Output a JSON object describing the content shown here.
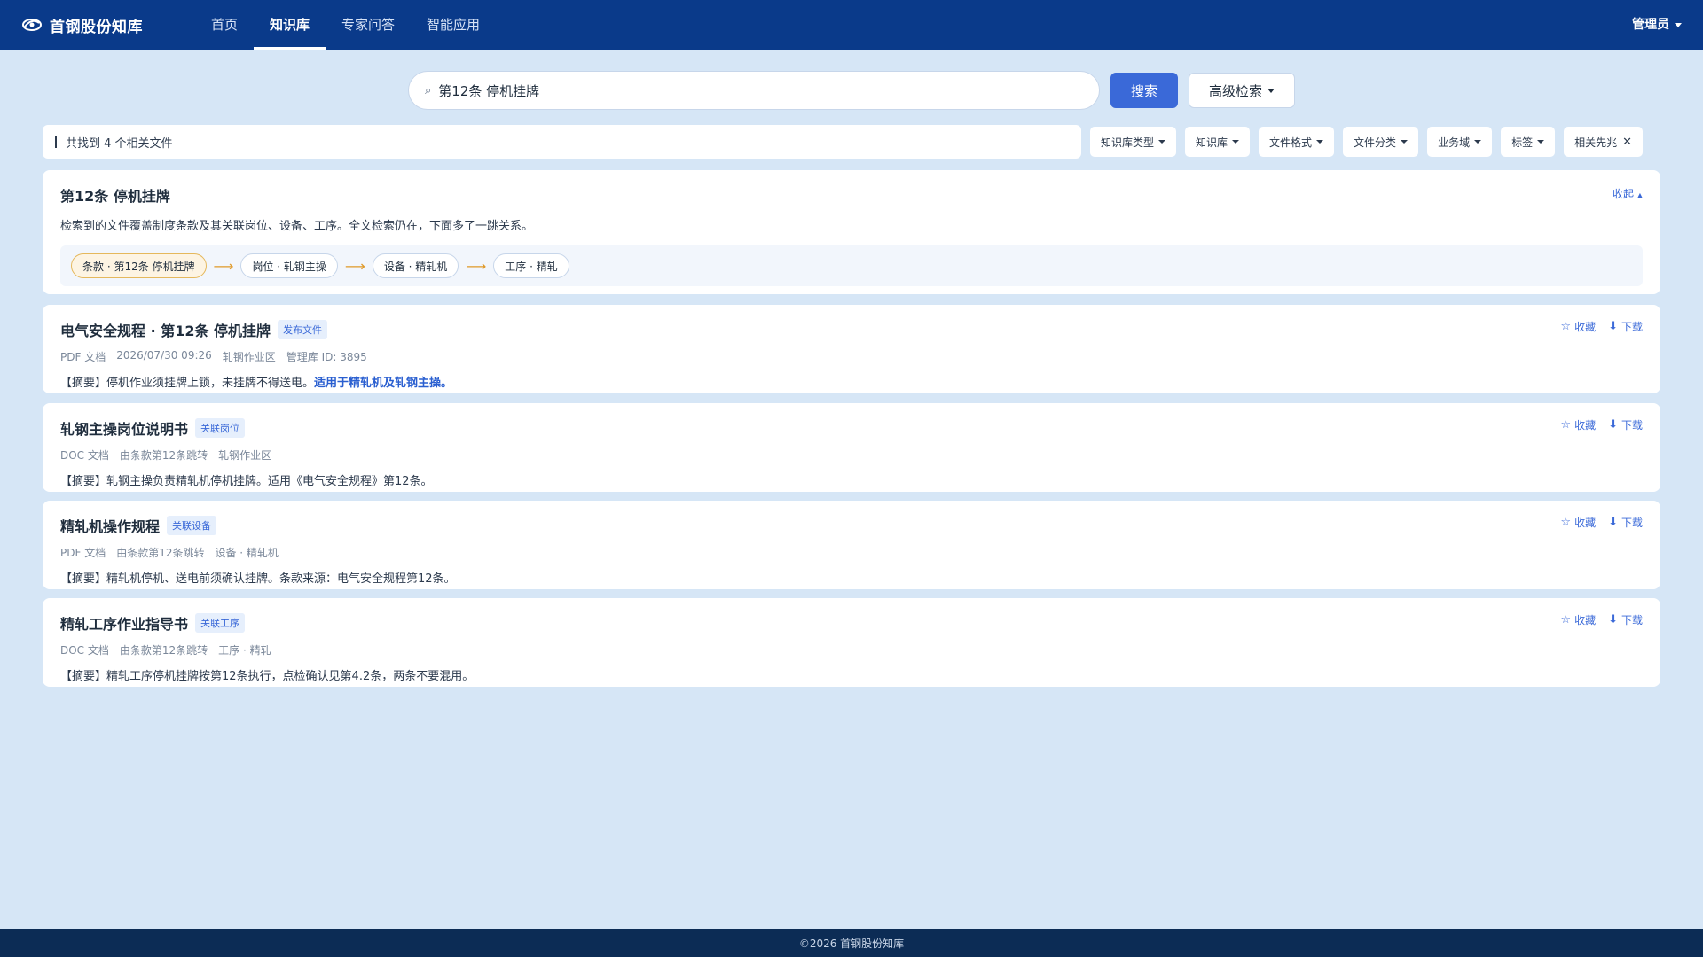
{
  "header": {
    "brand": "首钢股份知库",
    "nav": [
      "首页",
      "知识库",
      "专家问答",
      "智能应用"
    ],
    "active_nav": 1,
    "user": "管理员"
  },
  "search": {
    "query": "第12条 停机挂牌",
    "search_label": "搜索",
    "advanced_label": "高级检索"
  },
  "filters": {
    "result_count": "共找到 4 个相关文件",
    "chips": [
      "知识库类型",
      "知识库",
      "文件格式",
      "文件分类",
      "业务域",
      "标签"
    ],
    "active_chip": "相关先兆"
  },
  "summary": {
    "title": "第12条 停机挂牌",
    "collapse": "收起",
    "description": "检索到的文件覆盖制度条款及其关联岗位、设备、工序。全文检索仍在，下面多了一跳关系。",
    "chain": [
      "条款 · 第12条 停机挂牌",
      "岗位 · 轧钢主操",
      "设备 · 精轧机",
      "工序 · 精轧"
    ]
  },
  "results": [
    {
      "title": "电气安全规程 · 第12条 停机挂牌",
      "tag": "发布文件",
      "meta": [
        "PDF 文档",
        "2026/07/30 09:26",
        "轧钢作业区",
        "管理库 ID: 3895"
      ],
      "abstract": "【摘要】停机作业须挂牌上锁，未挂牌不得送电。",
      "abstract_highlight": "适用于精轧机及轧钢主操。",
      "fav": "收藏",
      "download": "下载"
    },
    {
      "title": "轧钢主操岗位说明书",
      "tag": "关联岗位",
      "meta": [
        "DOC 文档",
        "由条款第12条跳转",
        "轧钢作业区"
      ],
      "abstract": "【摘要】轧钢主操负责精轧机停机挂牌。适用《电气安全规程》第12条。",
      "abstract_highlight": "",
      "fav": "收藏",
      "download": "下载"
    },
    {
      "title": "精轧机操作规程",
      "tag": "关联设备",
      "meta": [
        "PDF 文档",
        "由条款第12条跳转",
        "设备 · 精轧机"
      ],
      "abstract": "【摘要】精轧机停机、送电前须确认挂牌。条款来源：电气安全规程第12条。",
      "abstract_highlight": "",
      "fav": "收藏",
      "download": "下载"
    },
    {
      "title": "精轧工序作业指导书",
      "tag": "关联工序",
      "meta": [
        "DOC 文档",
        "由条款第12条跳转",
        "工序 · 精轧"
      ],
      "abstract": "【摘要】精轧工序停机挂牌按第12条执行，点检确认见第4.2条，两条不要混用。",
      "abstract_highlight": "",
      "fav": "收藏",
      "download": "下载"
    }
  ],
  "footer": "©2026 首钢股份知库",
  "colors": {
    "header": "#0a3a8a",
    "background": "#d6e6f6",
    "accent": "#3a69d8",
    "footer": "#0c2c55",
    "chain_highlight": "#fdf4e3"
  }
}
